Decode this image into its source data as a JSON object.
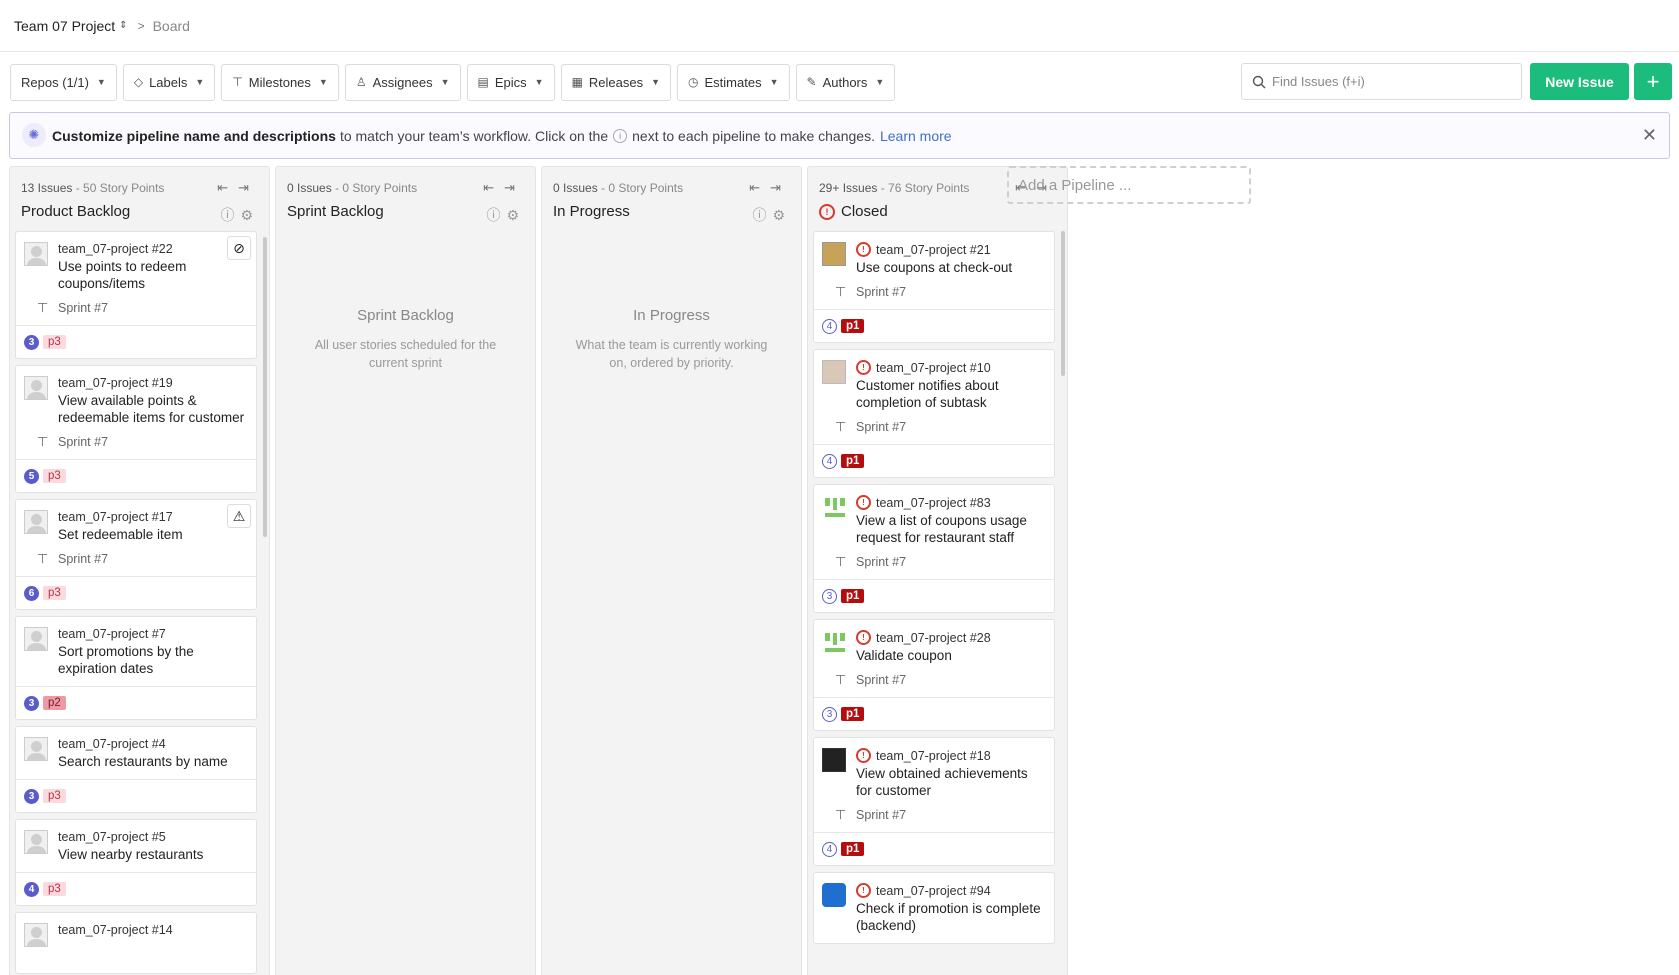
{
  "header": {
    "project": "Team 07 Project",
    "project_caret": "⌃⌄",
    "separator": ">",
    "breadcrumb": "Board"
  },
  "filters": {
    "repos": "Repos (1/1)",
    "labels": "Labels",
    "milestones": "Milestones",
    "assignees": "Assignees",
    "epics": "Epics",
    "releases": "Releases",
    "estimates": "Estimates",
    "authors": "Authors"
  },
  "search": {
    "placeholder": "Find Issues (f+i)",
    "value": ""
  },
  "new_issue_label": "New Issue",
  "plus_label": "+",
  "banner": {
    "bold": "Customize pipeline name and descriptions",
    "text1": "to match your team’s workflow. Click on the",
    "text2": "next to each pipeline to make changes.",
    "link": "Learn more",
    "close": "✕"
  },
  "pipelines": [
    {
      "issues": "13 Issues",
      "points": "- 50 Story Points",
      "name": "Product Backlog"
    },
    {
      "issues": "0 Issues",
      "points": "- 0 Story Points",
      "name": "Sprint Backlog",
      "empty_title": "Sprint Backlog",
      "empty_desc": "All user stories scheduled for the current sprint"
    },
    {
      "issues": "0 Issues",
      "points": "- 0 Story Points",
      "name": "In Progress",
      "empty_title": "In Progress",
      "empty_desc": "What the team is currently working on, ordered by priority."
    },
    {
      "issues": "29+ Issues",
      "points": "- 76 Story Points",
      "name": "Closed"
    }
  ],
  "add_pipeline": "Add a Pipeline ...",
  "backlog_cards": [
    {
      "ref": "team_07-project #22",
      "title": "Use points to redeem coupons/items",
      "sprint": "Sprint #7",
      "estimate": "3",
      "label": "p3",
      "badge": "⊘"
    },
    {
      "ref": "team_07-project #19",
      "title": "View available points & redeemable items for customer",
      "sprint": "Sprint #7",
      "estimate": "5",
      "label": "p3"
    },
    {
      "ref": "team_07-project #17",
      "title": "Set redeemable item",
      "sprint": "Sprint #7",
      "estimate": "6",
      "label": "p3",
      "badge": "⚠"
    },
    {
      "ref": "team_07-project #7",
      "title": "Sort promotions by the expiration dates",
      "estimate": "3",
      "label": "p2"
    },
    {
      "ref": "team_07-project #4",
      "title": "Search restaurants by name",
      "estimate": "3",
      "label": "p3"
    },
    {
      "ref": "team_07-project #5",
      "title": "View nearby restaurants",
      "estimate": "4",
      "label": "p3"
    },
    {
      "ref": "team_07-project #14",
      "title": ""
    }
  ],
  "closed_cards": [
    {
      "ref": "team_07-project #21",
      "title": "Use coupons at check-out",
      "sprint": "Sprint #7",
      "estimate": "4",
      "label": "p1"
    },
    {
      "ref": "team_07-project #10",
      "title": "Customer notifies about completion of subtask",
      "sprint": "Sprint #7",
      "estimate": "4",
      "label": "p1"
    },
    {
      "ref": "team_07-project #83",
      "title": "View a list of coupons usage request for restaurant staff",
      "sprint": "Sprint #7",
      "estimate": "3",
      "label": "p1"
    },
    {
      "ref": "team_07-project #28",
      "title": "Validate coupon",
      "sprint": "Sprint #7",
      "estimate": "3",
      "label": "p1"
    },
    {
      "ref": "team_07-project #18",
      "title": "View obtained achievements for customer",
      "sprint": "Sprint #7",
      "estimate": "4",
      "label": "p1"
    },
    {
      "ref": "team_07-project #94",
      "title": "Check if promotion is complete (backend)"
    }
  ]
}
